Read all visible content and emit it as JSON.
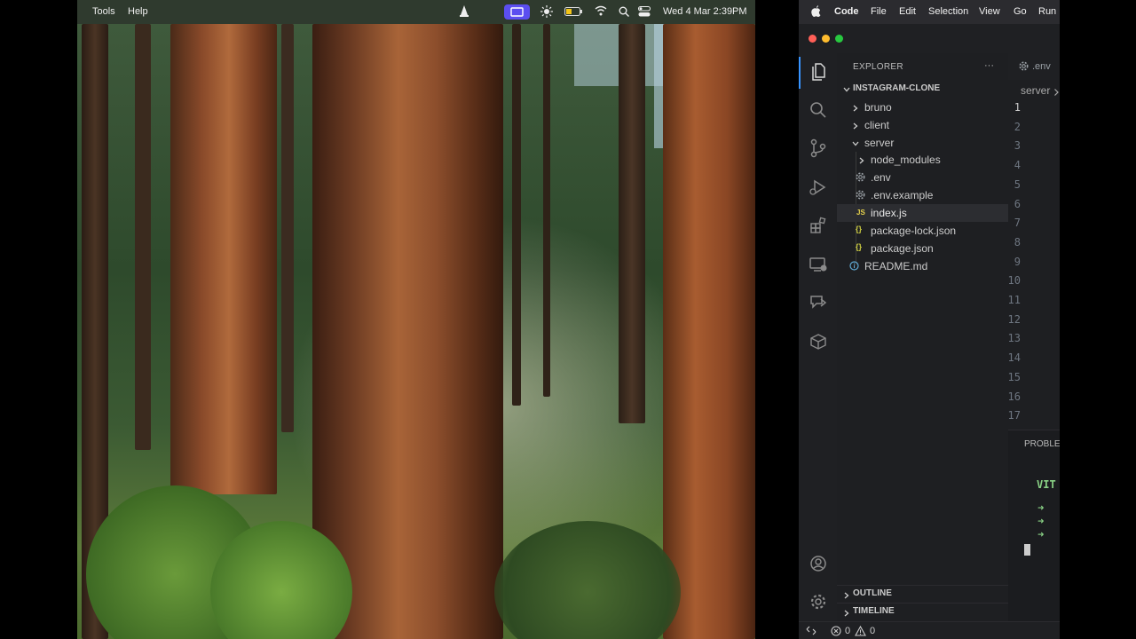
{
  "left_menubar": {
    "items": [
      "Tools",
      "Help"
    ],
    "datetime": "Wed 4 Mar  2:39PM"
  },
  "vscode_menubar": {
    "items": [
      "Code",
      "File",
      "Edit",
      "Selection",
      "View",
      "Go",
      "Run"
    ]
  },
  "explorer": {
    "title": "EXPLORER",
    "more": "···",
    "project": "INSTAGRAM-CLONE",
    "tree": [
      {
        "label": "bruno",
        "type": "folder",
        "expanded": false
      },
      {
        "label": "client",
        "type": "folder",
        "expanded": false
      },
      {
        "label": "server",
        "type": "folder",
        "expanded": true
      },
      {
        "label": "node_modules",
        "type": "folder",
        "expanded": false
      },
      {
        "label": ".env",
        "type": "gear"
      },
      {
        "label": ".env.example",
        "type": "gear"
      },
      {
        "label": "index.js",
        "type": "js",
        "icon_text": "JS",
        "selected": true
      },
      {
        "label": "package-lock.json",
        "type": "json",
        "icon_text": "{}"
      },
      {
        "label": "package.json",
        "type": "json",
        "icon_text": "{}"
      },
      {
        "label": "README.md",
        "type": "info"
      }
    ],
    "outline": "OUTLINE",
    "timeline": "TIMELINE"
  },
  "editor": {
    "tab_label": ".env",
    "breadcrumb": "server",
    "line_numbers": [
      "1",
      "2",
      "3",
      "4",
      "5",
      "6",
      "7",
      "8",
      "9",
      "10",
      "11",
      "12",
      "13",
      "14",
      "15",
      "16",
      "17"
    ]
  },
  "panel": {
    "tab": "PROBLE",
    "terminal_text": "VIT"
  },
  "statusbar": {
    "errors": "0",
    "warnings": "0"
  },
  "colors": {
    "accent": "#3794ff",
    "folder_text": "#cccccc",
    "js_icon": "#e8d44d",
    "json_icon": "#cbcb41",
    "terminal_green": "#89d185"
  }
}
